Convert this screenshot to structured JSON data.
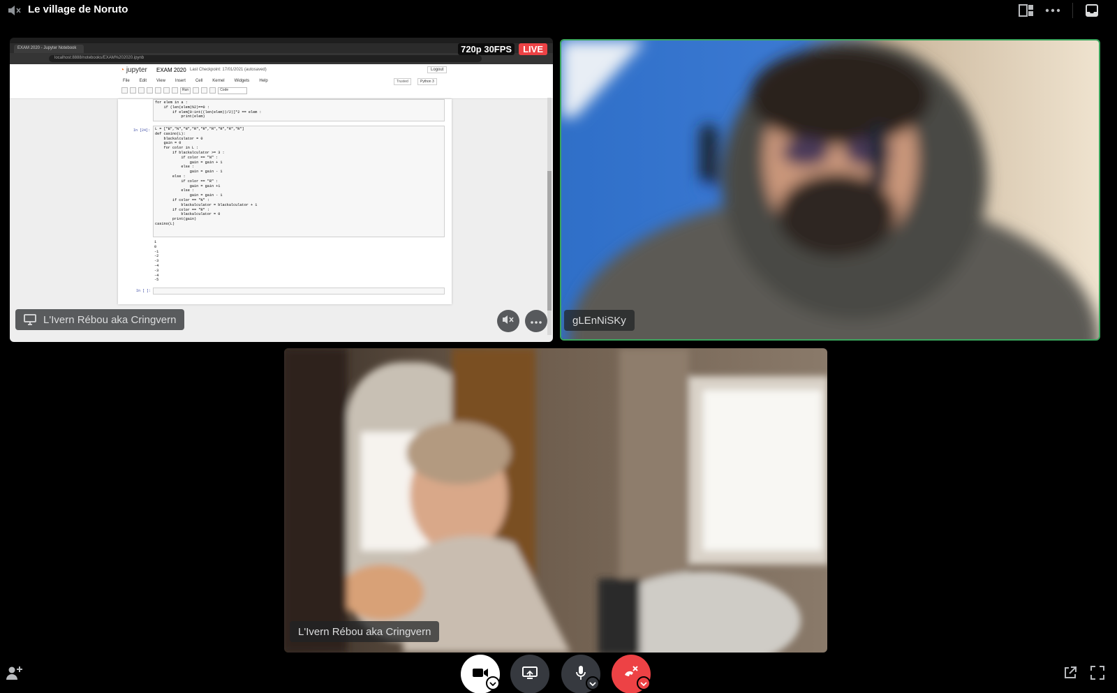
{
  "header": {
    "channel_name": "Le village de Noruto",
    "icons": [
      "speaker-muted-icon",
      "grid-layout-icon",
      "more-icon",
      "inbox-icon"
    ]
  },
  "tiles": {
    "stream": {
      "user_label": "L'Ivern Rébou aka Cringvern",
      "quality": "720p 30FPS",
      "live": "LIVE",
      "browser_tab": "EXAM 2020 - Jupyter Notebook",
      "url": "localhost:8888/notebooks/EXAM%202020.ipynb",
      "jupyter": {
        "logo": "jupyter",
        "title": "EXAM 2020",
        "checkpoint": "Last Checkpoint: 17/01/2021  (autosaved)",
        "logout": "Logout",
        "menu": [
          "File",
          "Edit",
          "View",
          "Insert",
          "Cell",
          "Kernel",
          "Widgets",
          "Help"
        ],
        "trusted": "Trusted",
        "kernel": "Python 3",
        "run": "Run",
        "cell_type": "Code",
        "cell1_code": "for elem in a :\n    if (len(elem)%2)==0 :\n        if elem[0:int((len(elem))/2)]*2 == elem :\n            print(elem)",
        "cell2_prompt": "In [24]:",
        "cell2_code": "L = [\"B\",\"N\",\"N\",\"R\",\"R\",\"R\",\"R\",\"R\",\"R\"]\ndef casino(L):\n    blackalculator = 0\n    gain = 0\n    for color in L :\n        if blackalculator >= 3 :\n            if color == \"N\" :\n                gain = gain + 1\n            else :\n                gain = gain - 1\n        else :\n            if color == \"R\" :\n                gain = gain +1\n            else :\n                gain = gain - 1\n        if color == \"N\" :\n            blackalculator = blackalculator + 1\n        if color == \"R\" :\n            blackalculator = 0\n        print(gain)\ncasino(L)",
        "cell2_output": "1\n0\n-1\n-2\n-3\n-4\n-3\n-4\n-5",
        "cell3_prompt": "In [ ]:"
      }
    },
    "glen": {
      "user_label": "gLEnNiSKy"
    },
    "cam": {
      "user_label": "L'Ivern Rébou aka Cringvern"
    }
  },
  "controls": {
    "icons": [
      "add-user-icon",
      "camera-icon",
      "screen-share-icon",
      "microphone-icon",
      "disconnect-icon",
      "popout-icon",
      "fullscreen-icon"
    ],
    "colors": {
      "camera_bg": "#ffffff",
      "share_bg": "#36393f",
      "disconnect_bg": "#ed4245",
      "speaking_border": "#3ba55d"
    }
  }
}
